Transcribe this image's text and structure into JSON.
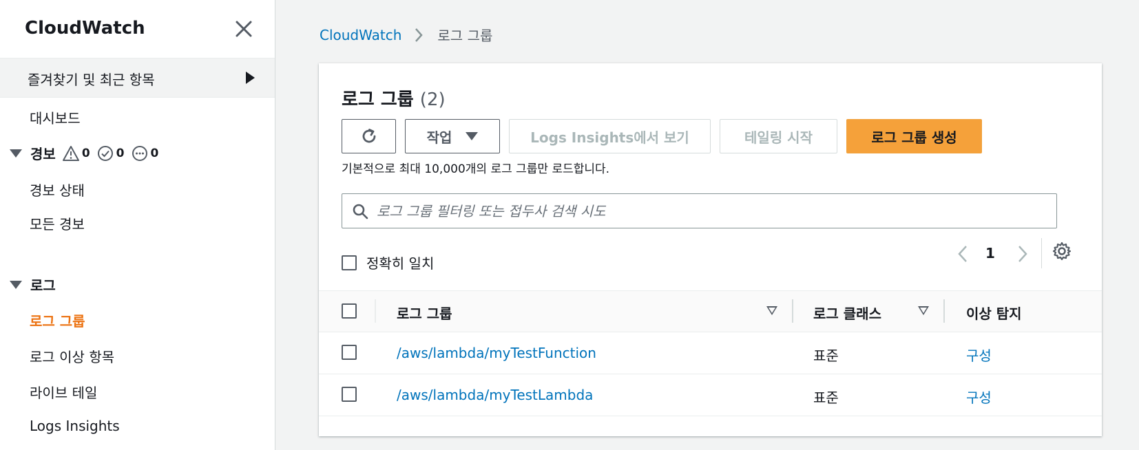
{
  "sidebar": {
    "title": "CloudWatch",
    "favorites_label": "즐겨찾기 및 최근 항목",
    "dashboard_label": "대시보드",
    "alarms": {
      "label": "경보",
      "in_alarm_count": "0",
      "ok_count": "0",
      "insufficient_count": "0",
      "items": [
        "경보 상태",
        "모든 경보"
      ]
    },
    "logs": {
      "label": "로그",
      "items": [
        "로그 그룹",
        "로그 이상 항목",
        "라이브 테일",
        "Logs Insights"
      ],
      "active_index": 0
    }
  },
  "breadcrumb": {
    "root": "CloudWatch",
    "current": "로그 그룹"
  },
  "panel": {
    "title": "로그 그룹",
    "count": "(2)",
    "buttons": {
      "action": "작업",
      "insights": "Logs Insights에서 보기",
      "tail": "테일링 시작",
      "create": "로그 그룹 생성"
    },
    "hint": "기본적으로 최대 10,000개의 로그 그룹만 로드합니다.",
    "search_placeholder": "로그 그룹 필터링 또는 접두사 검색 시도",
    "exact_match_label": "정확히 일치",
    "page_number": "1",
    "columns": {
      "log_group": "로그 그룹",
      "log_class": "로그 클래스",
      "anomaly": "이상 탐지"
    },
    "rows": [
      {
        "name": "/aws/lambda/myTestFunction",
        "log_class": "표준",
        "anomaly": "구성"
      },
      {
        "name": "/aws/lambda/myTestLambda",
        "log_class": "표준",
        "anomaly": "구성"
      }
    ]
  },
  "colors": {
    "link": "#0073bb",
    "active_nav": "#ec7211",
    "primary_button": "#f5a13a"
  }
}
